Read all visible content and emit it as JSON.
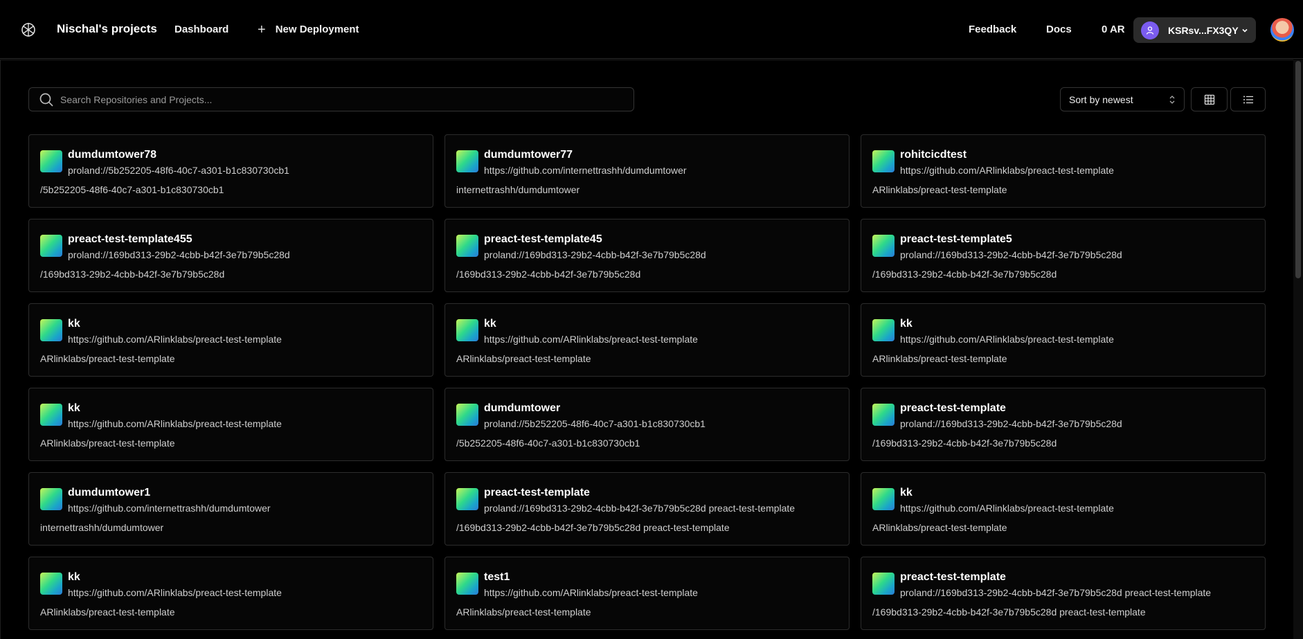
{
  "header": {
    "project_title": "Nischal's projects",
    "nav_dashboard": "Dashboard",
    "new_deployment": "New Deployment",
    "feedback": "Feedback",
    "docs": "Docs",
    "balance": "0 AR",
    "wallet_address": "KSRsv...FX3QY"
  },
  "toolbar": {
    "search_placeholder": "Search Repositories and Projects...",
    "sort_label": "Sort by newest"
  },
  "projects": [
    {
      "name": "dumdumtower78",
      "url": "proland://5b252205-48f6-40c7-a301-b1c830730cb1",
      "path": "/5b252205-48f6-40c7-a301-b1c830730cb1"
    },
    {
      "name": "dumdumtower77",
      "url": "https://github.com/internettrashh/dumdumtower",
      "path": "internettrashh/dumdumtower"
    },
    {
      "name": "rohitcicdtest",
      "url": "https://github.com/ARlinklabs/preact-test-template",
      "path": "ARlinklabs/preact-test-template"
    },
    {
      "name": "preact-test-template455",
      "url": "proland://169bd313-29b2-4cbb-b42f-3e7b79b5c28d",
      "path": "/169bd313-29b2-4cbb-b42f-3e7b79b5c28d"
    },
    {
      "name": "preact-test-template45",
      "url": "proland://169bd313-29b2-4cbb-b42f-3e7b79b5c28d",
      "path": "/169bd313-29b2-4cbb-b42f-3e7b79b5c28d"
    },
    {
      "name": "preact-test-template5",
      "url": "proland://169bd313-29b2-4cbb-b42f-3e7b79b5c28d",
      "path": "/169bd313-29b2-4cbb-b42f-3e7b79b5c28d"
    },
    {
      "name": "kk",
      "url": "https://github.com/ARlinklabs/preact-test-template",
      "path": "ARlinklabs/preact-test-template"
    },
    {
      "name": "kk",
      "url": "https://github.com/ARlinklabs/preact-test-template",
      "path": "ARlinklabs/preact-test-template"
    },
    {
      "name": "kk",
      "url": "https://github.com/ARlinklabs/preact-test-template",
      "path": "ARlinklabs/preact-test-template"
    },
    {
      "name": "kk",
      "url": "https://github.com/ARlinklabs/preact-test-template",
      "path": "ARlinklabs/preact-test-template"
    },
    {
      "name": "dumdumtower",
      "url": "proland://5b252205-48f6-40c7-a301-b1c830730cb1",
      "path": "/5b252205-48f6-40c7-a301-b1c830730cb1"
    },
    {
      "name": "preact-test-template",
      "url": "proland://169bd313-29b2-4cbb-b42f-3e7b79b5c28d",
      "path": "/169bd313-29b2-4cbb-b42f-3e7b79b5c28d"
    },
    {
      "name": "dumdumtower1",
      "url": "https://github.com/internettrashh/dumdumtower",
      "path": "internettrashh/dumdumtower"
    },
    {
      "name": "preact-test-template",
      "url": "proland://169bd313-29b2-4cbb-b42f-3e7b79b5c28d preact-test-template",
      "path": "/169bd313-29b2-4cbb-b42f-3e7b79b5c28d preact-test-template"
    },
    {
      "name": "kk",
      "url": "https://github.com/ARlinklabs/preact-test-template",
      "path": "ARlinklabs/preact-test-template"
    },
    {
      "name": "kk",
      "url": "https://github.com/ARlinklabs/preact-test-template",
      "path": "ARlinklabs/preact-test-template"
    },
    {
      "name": "test1",
      "url": "https://github.com/ARlinklabs/preact-test-template",
      "path": "ARlinklabs/preact-test-template"
    },
    {
      "name": "preact-test-template",
      "url": "proland://169bd313-29b2-4cbb-b42f-3e7b79b5c28d preact-test-template",
      "path": "/169bd313-29b2-4cbb-b42f-3e7b79b5c28d preact-test-template"
    }
  ],
  "icons": {
    "logo": "app-logo-icon",
    "plus": "plus-icon",
    "search": "search-icon",
    "sort": "sort-arrows-icon",
    "grid": "grid-view-icon",
    "list": "list-view-icon",
    "user": "user-icon",
    "chevron": "chevron-down-icon"
  },
  "colors": {
    "background": "#000000",
    "card_border": "#2c2c2c",
    "wallet_bg": "#2b2b2b",
    "wallet_avatar": "#7b5cf0"
  }
}
